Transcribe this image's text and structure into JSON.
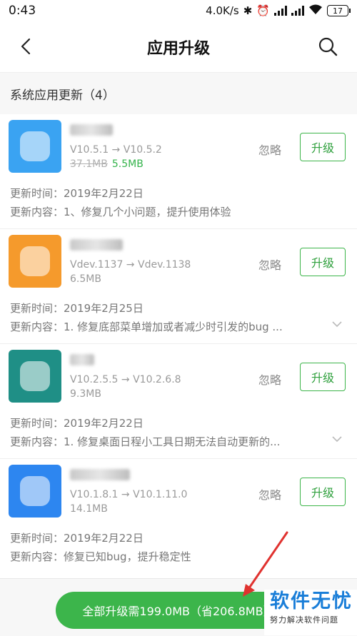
{
  "status_bar": {
    "time": "0:43",
    "speed": "4.0K/s",
    "battery": "17"
  },
  "header": {
    "title": "应用升级"
  },
  "section": {
    "title": "系统应用更新（4）"
  },
  "labels": {
    "ignore": "忽略",
    "upgrade": "升级",
    "time_prefix": "更新时间：",
    "content_prefix": "更新内容："
  },
  "apps": [
    {
      "version": "V10.5.1 → V10.5.2",
      "old_size": "37.1MB",
      "new_size": "5.5MB",
      "date": "2019年2月22日",
      "content": "1、修复几个小问题，提升使用体验",
      "icon_color": "#3aa3f2"
    },
    {
      "version": "Vdev.1137 → Vdev.1138",
      "size": "6.5MB",
      "date": "2019年2月25日",
      "content": "1. 修复底部菜单增加或者减少时引发的bug ...",
      "icon_color": "#f59a2c"
    },
    {
      "version": "V10.2.5.5 → V10.2.6.8",
      "size": "9.3MB",
      "date": "2019年2月22日",
      "content": "1. 修复桌面日程小工具日期无法自动更新的...",
      "icon_color": "#1f8f86"
    },
    {
      "version": "V10.1.8.1 → V10.1.11.0",
      "size": "14.1MB",
      "date": "2019年2月22日",
      "content": "修复已知bug，提升稳定性",
      "icon_color": "#2d86f0"
    }
  ],
  "bottom": {
    "upgrade_all": "全部升级需199.0MB（省206.8MB）"
  },
  "watermark": {
    "main": "软件无忧",
    "sub": "努力解决软件问题"
  },
  "colors": {
    "accent": "#3cb54b",
    "annotation": "#e0322f"
  }
}
